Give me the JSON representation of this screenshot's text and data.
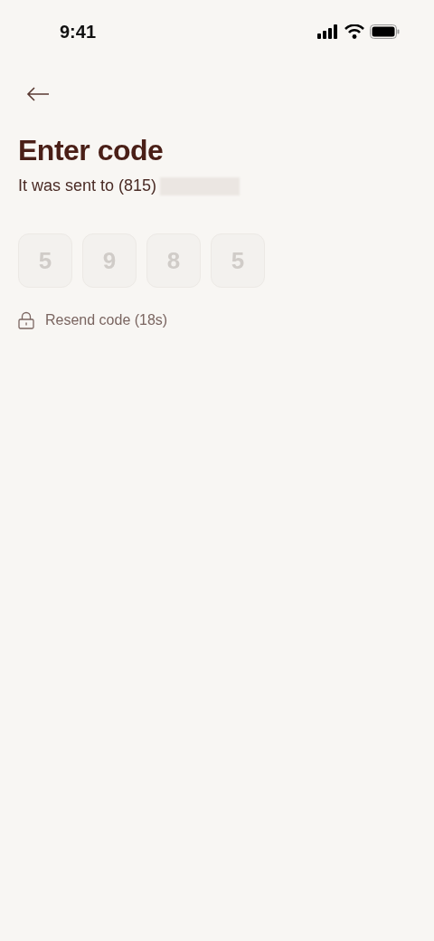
{
  "status_bar": {
    "time": "9:41"
  },
  "title": "Enter code",
  "subtitle": "It was sent to (815)",
  "code_digits": [
    {
      "value": "5",
      "disabled": true
    },
    {
      "value": "9",
      "disabled": true
    },
    {
      "value": "8",
      "disabled": true
    },
    {
      "value": "5",
      "disabled": true
    }
  ],
  "resend": {
    "label": "Resend code (18s)",
    "disabled": true
  }
}
